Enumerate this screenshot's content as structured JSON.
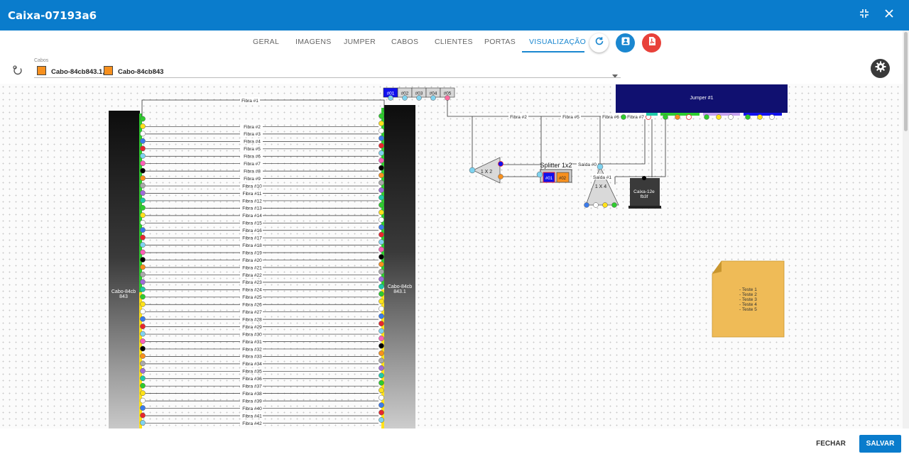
{
  "window": {
    "title": "Caixa-07193a6"
  },
  "tabs": [
    {
      "label": "GERAL"
    },
    {
      "label": "IMAGENS"
    },
    {
      "label": "JUMPER"
    },
    {
      "label": "CABOS"
    },
    {
      "label": "CLIENTES"
    },
    {
      "label": "PORTAS"
    },
    {
      "label": "VISUALIZAÇÃO"
    }
  ],
  "cables": {
    "label": "Cabos",
    "selected": [
      {
        "name": "Cabo-84cb843.1,",
        "color": "#f7901e"
      },
      {
        "name": "Cabo-84cb843",
        "color": "#f7901e"
      }
    ]
  },
  "diagram": {
    "left_cable": {
      "label1": "Cabo-84cb",
      "label2": "843"
    },
    "right_cable": {
      "label1": "Cabo-84cb",
      "label2": "843.1"
    },
    "fibers": [
      "Fibra #1",
      "Fibra #2",
      "Fibra #3",
      "Fibra #4",
      "Fibra #5",
      "Fibra #6",
      "Fibra #7",
      "Fibra #8",
      "Fibra #9",
      "Fibra #10",
      "Fibra #11",
      "Fibra #12",
      "Fibra #13",
      "Fibra #14",
      "Fibra #15",
      "Fibra #16",
      "Fibra #17",
      "Fibra #18",
      "Fibra #19",
      "Fibra #20",
      "Fibra #21",
      "Fibra #22",
      "Fibra #23",
      "Fibra #24",
      "Fibra #25",
      "Fibra #26",
      "Fibra #27",
      "Fibra #28",
      "Fibra #29",
      "Fibra #30",
      "Fibra #31",
      "Fibra #32",
      "Fibra #33",
      "Fibra #34",
      "Fibra #35",
      "Fibra #36",
      "Fibra #37",
      "Fibra #38",
      "Fibra #39",
      "Fibra #40",
      "Fibra #41",
      "Fibra #42"
    ],
    "ports": [
      "#01",
      "#02",
      "#03",
      "#04",
      "#05"
    ],
    "jumper": {
      "label": "Jumper #1"
    },
    "route_labels": [
      "Fibra #2",
      "Fibra #5",
      "Fibra #6",
      "Fibra #7"
    ],
    "splitter_1x2": {
      "label": "1 X 2",
      "title": "Splitter 1x2",
      "out1": "#01",
      "out2": "#02",
      "saida0": "Saída #0"
    },
    "splitter_1x4": {
      "label": "1 X 4",
      "saida1": "Saída #1"
    },
    "box": {
      "line1": "Caixa-12e",
      "line2": "fb3f"
    },
    "note": [
      "- Teste 1",
      "- Teste 2",
      "- Teste 3",
      "- Teste 4",
      "- Teste 5"
    ],
    "fiber_colors": [
      "#2ecc2e",
      "#ffe21a",
      "#ffffff",
      "#3b7bea",
      "#e8262d",
      "#7fd3f0",
      "#ff5fb7",
      "#000000",
      "#f7901e",
      "#a9a9a9",
      "#9f6bd8",
      "#1fc9a8"
    ]
  },
  "footer": {
    "close_label": "FECHAR",
    "save_label": "SALVAR"
  }
}
